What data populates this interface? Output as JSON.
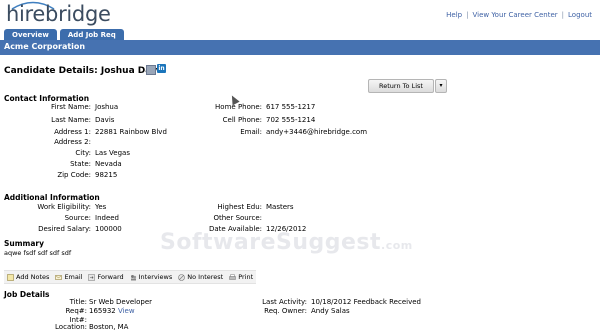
{
  "brand": {
    "logo_text": "hirebridge"
  },
  "top_links": [
    "Help",
    "View Your Career Center",
    "Logout"
  ],
  "tabs": [
    "Overview",
    "Add Job Req"
  ],
  "company": "Acme Corporation",
  "candidate": {
    "title": "Candidate Details: Joshua Davis"
  },
  "buttons": {
    "return": "Return To List",
    "dropdown": "▾"
  },
  "contact": {
    "heading": "Contact Information",
    "left": [
      {
        "label": "First Name:",
        "value": "Joshua"
      },
      {
        "label": "Last Name:",
        "value": "Davis"
      },
      {
        "label": "Address 1:",
        "value": "22881 Rainbow Blvd"
      },
      {
        "label": "Address 2:",
        "value": ""
      },
      {
        "label": "City:",
        "value": "Las Vegas"
      },
      {
        "label": "State:",
        "value": "Nevada"
      },
      {
        "label": "Zip Code:",
        "value": "98215"
      }
    ],
    "right": [
      {
        "label": "Home Phone:",
        "value": "617 555-1217"
      },
      {
        "label": "Cell Phone:",
        "value": "702 555-1214"
      },
      {
        "label": "Email:",
        "value": "andy+3446@hirebridge.com"
      }
    ]
  },
  "additional": {
    "heading": "Additional Information",
    "left": [
      {
        "label": "Work Eligibility:",
        "value": "Yes"
      },
      {
        "label": "Source:",
        "value": "Indeed"
      },
      {
        "label": "Desired Salary:",
        "value": "100000"
      }
    ],
    "right": [
      {
        "label": "Highest Edu:",
        "value": "Masters"
      },
      {
        "label": "Other Source:",
        "value": ""
      },
      {
        "label": "Date Available:",
        "value": "12/26/2012"
      }
    ]
  },
  "summary": {
    "heading": "Summary",
    "text": "aqwe fsdf sdf sdf sdf"
  },
  "actions": [
    "Add Notes",
    "Email",
    "Forward",
    "Interviews",
    "No Interest",
    "Print"
  ],
  "job": {
    "heading": "Job Details",
    "left": [
      {
        "label": "Title:",
        "value": "Sr Web Developer"
      },
      {
        "label": "Req#:",
        "value": "165932",
        "link": "View"
      },
      {
        "label": "Int#:",
        "value": ""
      },
      {
        "label": "Location:",
        "value": "Boston, MA"
      }
    ],
    "right": [
      {
        "label": "Last Activity:",
        "value": "10/18/2012 Feedback Received"
      },
      {
        "label": "Req. Owner:",
        "value": "Andy Salas"
      }
    ]
  },
  "watermark": {
    "main": "SoftwareSuggest",
    "suffix": ".com"
  },
  "colors": {
    "nav_blue": "#4672b1",
    "tab_blue": "#3c6dac",
    "link_blue": "#3f62a5"
  }
}
